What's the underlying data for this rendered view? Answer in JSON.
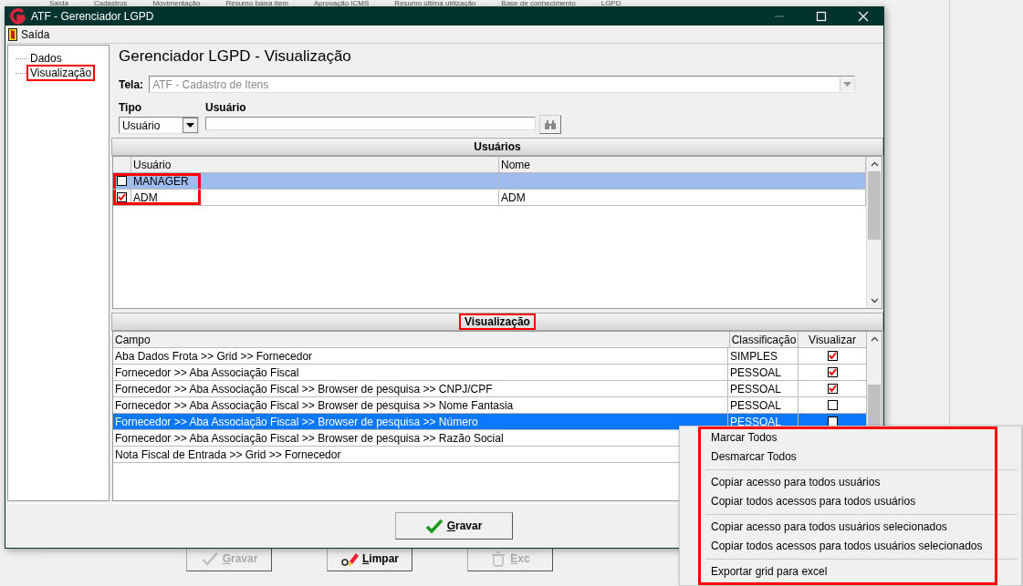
{
  "background_window": {
    "menu": [
      "Saída",
      "Cadastros",
      "Movimentação",
      "Resumo baixa item",
      "Aprovação ICMS",
      "Resumo última utilização",
      "Base de conhecimento",
      "LGPD"
    ],
    "buttons": [
      {
        "label": "Gravar",
        "kind": "check",
        "disabled": true
      },
      {
        "label": "Limpar",
        "kind": "eraser",
        "disabled": false
      },
      {
        "label": "Exc",
        "kind": "trash",
        "disabled": true
      }
    ]
  },
  "window": {
    "title": "ATF - Gerenciador LGPD"
  },
  "menu": [
    "Saída"
  ],
  "tree": {
    "items": [
      {
        "label": "Dados",
        "highlighted": false
      },
      {
        "label": "Visualização",
        "highlighted": true
      }
    ]
  },
  "heading": "Gerenciador LGPD - Visualização",
  "form": {
    "tela_label": "Tela:",
    "tela_value": "ATF - Cadastro de Itens",
    "tela_disabled": true,
    "tipo_label": "Tipo",
    "tipo_value": "Usuário",
    "usuario_label": "Usuário"
  },
  "users": {
    "title": "Usuários",
    "highlighted": false,
    "columns": [
      "Usuário",
      "Nome"
    ],
    "rows_highlighted": true,
    "rows": [
      {
        "checked": false,
        "selected": true,
        "usuario": "MANAGER"
      },
      {
        "checked": true,
        "selected": false,
        "usuario": "ADM",
        "nome": "ADM"
      }
    ]
  },
  "fields": {
    "title": "Visualização",
    "highlighted": true,
    "columns": [
      "Campo",
      "Classificação",
      "Visualizar"
    ],
    "rows": [
      {
        "campo": "Aba Dados Frota >> Grid >> Fornecedor",
        "classificacao": "SIMPLES",
        "visualizar": true,
        "selected": false
      },
      {
        "campo": "Fornecedor >> Aba Associação Fiscal",
        "classificacao": "PESSOAL",
        "visualizar": true,
        "selected": false
      },
      {
        "campo": "Fornecedor >> Aba Associação Fiscal >> Browser de pesquisa >> CNPJ/CPF",
        "classificacao": "PESSOAL",
        "visualizar": true,
        "selected": false
      },
      {
        "campo": "Fornecedor >> Aba Associação Fiscal >> Browser de pesquisa >> Nome Fantasia",
        "classificacao": "PESSOAL",
        "visualizar": false,
        "selected": false
      },
      {
        "campo": "Fornecedor >> Aba Associação Fiscal >> Browser de pesquisa >> Número",
        "classificacao": "PESSOAL",
        "visualizar": false,
        "selected": true
      },
      {
        "campo": "Fornecedor >> Aba Associação Fiscal >> Browser de pesquisa >> Razão Social",
        "selected": false
      },
      {
        "campo": "Nota Fiscal de Entrada >> Grid >> Fornecedor",
        "selected": false
      }
    ]
  },
  "buttons": [
    {
      "label": "Gravar",
      "kind": "check",
      "disabled": false
    }
  ],
  "context_menu": {
    "highlighted": true,
    "groups": [
      [
        "Marcar Todos",
        "Desmarcar Todos"
      ],
      [
        "Copiar acesso para todos usuários",
        "Copiar todos acessos para todos usuários"
      ],
      [
        "Copiar acesso para todos usuários selecionados",
        "Copiar todos acessos para todos usuários selecionados"
      ],
      [
        "Exportar grid para excel"
      ]
    ]
  }
}
